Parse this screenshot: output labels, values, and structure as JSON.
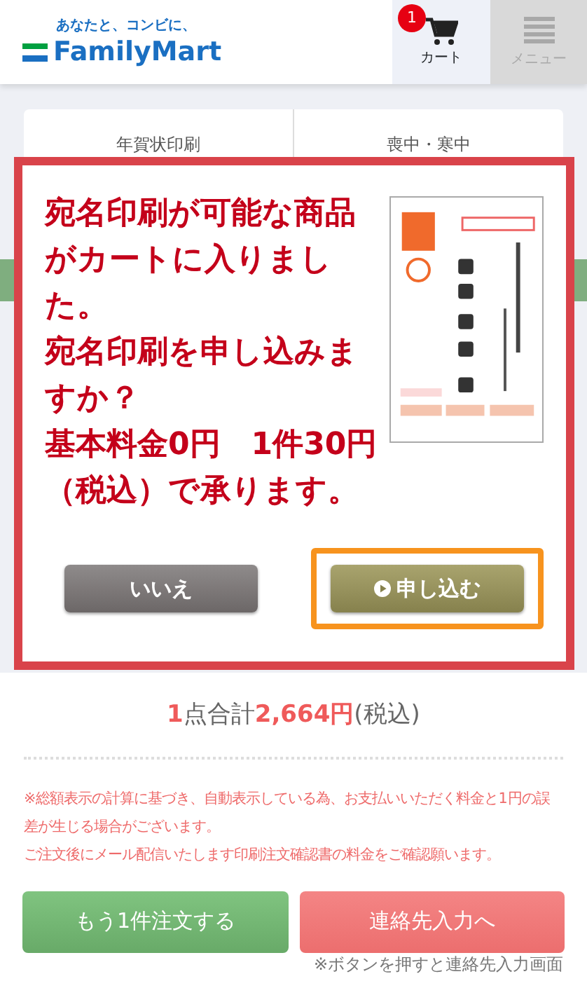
{
  "header": {
    "tagline": "あなたと、コンビに、",
    "logo": "FamilyMart",
    "cart": {
      "label": "カート",
      "badge": "1"
    },
    "menu": {
      "label": "メニュー"
    }
  },
  "tabs": [
    {
      "label": "年賀状印刷"
    },
    {
      "label": "喪中・寒中"
    }
  ],
  "dialog": {
    "message": [
      "宛名印刷が可能な商品がカートに入りました。",
      "宛名印刷を申し込みますか？",
      "基本料金0円　1件30円（税込）で承ります。"
    ],
    "buttons": [
      {
        "label": "いいえ",
        "kind": "secondary",
        "highlighted": false
      },
      {
        "label": "申し込む",
        "kind": "primary",
        "highlighted": true
      }
    ]
  },
  "summary": {
    "count": "1",
    "count_label": "点合計",
    "total": "2,664円",
    "tax": "(税込)"
  },
  "notes": [
    "※総額表示の計算に基づき、自動表示している為、お支払いいただく料金と1円の誤差が生じる場合がございます。",
    "ご注文後にメール配信いたします印刷注文確認書の料金をご確認願います。"
  ],
  "actions": [
    {
      "label": "もう1件注文する",
      "kind": "green"
    },
    {
      "label": "連絡先入力へ",
      "kind": "red"
    }
  ],
  "footnote": "※ボタンを押すと連絡先入力画面"
}
